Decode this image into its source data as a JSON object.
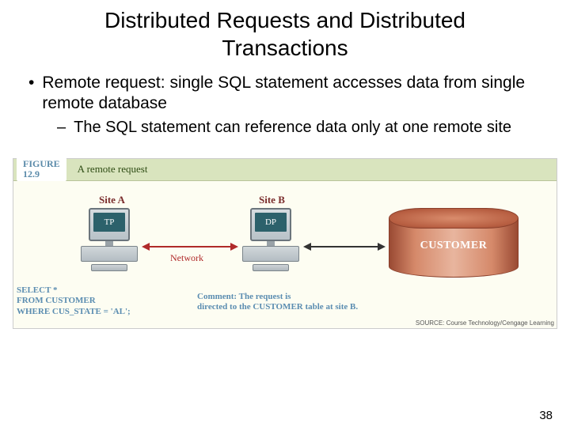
{
  "title": "Distributed Requests and Distributed Transactions",
  "bullets": {
    "main": "Remote request: single SQL statement accesses data from single remote database",
    "sub": "The SQL statement can reference data only at one remote site"
  },
  "figure": {
    "number_label": "FIGURE\n12.9",
    "title": "A remote request",
    "site_a_label": "Site A",
    "site_b_label": "Site B",
    "tp_label": "TP",
    "dp_label": "DP",
    "network_label": "Network",
    "db_label": "CUSTOMER",
    "sql_line1": "SELECT *",
    "sql_line2": "FROM CUSTOMER",
    "sql_line3": "WHERE CUS_STATE = 'AL';",
    "comment_line1": "Comment: The request is",
    "comment_line2": "directed to the CUSTOMER table at site B.",
    "source": "SOURCE: Course Technology/Cengage Learning"
  },
  "page_number": "38"
}
